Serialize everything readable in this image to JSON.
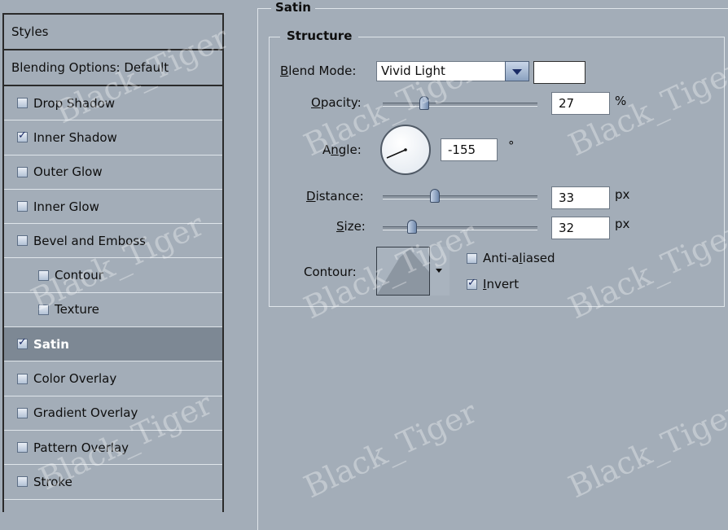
{
  "styles_list": {
    "header": "Styles",
    "blending_options": "Blending Options: Default",
    "items": [
      {
        "label": "Drop Shadow",
        "checked": false,
        "sub": false,
        "selected": false
      },
      {
        "label": "Inner Shadow",
        "checked": true,
        "sub": false,
        "selected": false
      },
      {
        "label": "Outer Glow",
        "checked": false,
        "sub": false,
        "selected": false
      },
      {
        "label": "Inner Glow",
        "checked": false,
        "sub": false,
        "selected": false
      },
      {
        "label": "Bevel and Emboss",
        "checked": false,
        "sub": false,
        "selected": false
      },
      {
        "label": "Contour",
        "checked": false,
        "sub": true,
        "selected": false
      },
      {
        "label": "Texture",
        "checked": false,
        "sub": true,
        "selected": false
      },
      {
        "label": "Satin",
        "checked": true,
        "sub": false,
        "selected": true
      },
      {
        "label": "Color Overlay",
        "checked": false,
        "sub": false,
        "selected": false
      },
      {
        "label": "Gradient Overlay",
        "checked": false,
        "sub": false,
        "selected": false
      },
      {
        "label": "Pattern Overlay",
        "checked": false,
        "sub": false,
        "selected": false
      },
      {
        "label": "Stroke",
        "checked": false,
        "sub": false,
        "selected": false
      }
    ]
  },
  "satin": {
    "title": "Satin",
    "structure_title": "Structure",
    "blend_mode": {
      "label_underlined": "B",
      "label_rest": "lend Mode:",
      "value": "Vivid Light",
      "swatch_color": "#ffffff"
    },
    "opacity": {
      "label_underlined": "O",
      "label_rest": "pacity:",
      "value": "27",
      "unit": "%",
      "percent": 27
    },
    "angle": {
      "label_pre": "A",
      "label_underlined": "n",
      "label_rest": "gle:",
      "value": "-155",
      "unit": "°",
      "degrees": -155
    },
    "distance": {
      "label_underlined": "D",
      "label_rest": "istance:",
      "value": "33",
      "unit": "px"
    },
    "size": {
      "label_underlined": "S",
      "label_rest": "ize:",
      "value": "32",
      "unit": "px"
    },
    "contour_label": "Contour:",
    "anti_aliased": {
      "label_pre": "Anti-a",
      "label_underlined": "l",
      "label_rest": "iased",
      "checked": false
    },
    "invert": {
      "label_underlined": "I",
      "label_rest": "nvert",
      "checked": true
    }
  },
  "watermark": "Black_Tiger",
  "colors": {
    "panel_bg": "#a3adb8",
    "selected_row": "#7d8894"
  }
}
